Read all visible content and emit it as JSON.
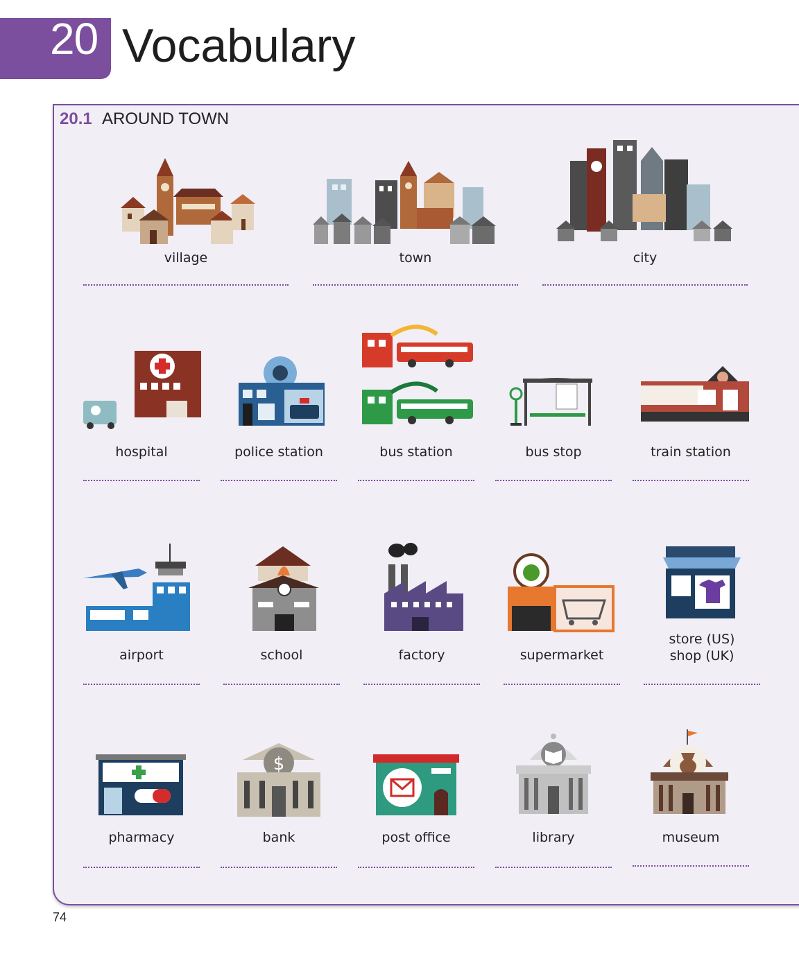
{
  "chapter": {
    "number": "20",
    "title": "Vocabulary"
  },
  "section": {
    "number": "20.1",
    "title": "AROUND TOWN"
  },
  "words": [
    {
      "label": "village",
      "icon": "village-icon"
    },
    {
      "label": "town",
      "icon": "town-icon"
    },
    {
      "label": "city",
      "icon": "city-icon"
    },
    {
      "label": "hospital",
      "icon": "hospital-icon"
    },
    {
      "label": "police station",
      "icon": "police-station-icon"
    },
    {
      "label": "bus station",
      "icon": "bus-station-icon"
    },
    {
      "label": "bus stop",
      "icon": "bus-stop-icon"
    },
    {
      "label": "train station",
      "icon": "train-station-icon"
    },
    {
      "label": "airport",
      "icon": "airport-icon"
    },
    {
      "label": "school",
      "icon": "school-icon"
    },
    {
      "label": "factory",
      "icon": "factory-icon"
    },
    {
      "label": "supermarket",
      "icon": "supermarket-icon"
    },
    {
      "label": "store (US)",
      "label2": "shop (UK)",
      "icon": "store-icon"
    },
    {
      "label": "pharmacy",
      "icon": "pharmacy-icon"
    },
    {
      "label": "bank",
      "icon": "bank-icon"
    },
    {
      "label": "post office",
      "icon": "post-office-icon"
    },
    {
      "label": "library",
      "icon": "library-icon"
    },
    {
      "label": "museum",
      "icon": "museum-icon"
    }
  ],
  "page_number": "74",
  "colors": {
    "accent": "#7b4e9e",
    "panel": "#f1eef6"
  }
}
